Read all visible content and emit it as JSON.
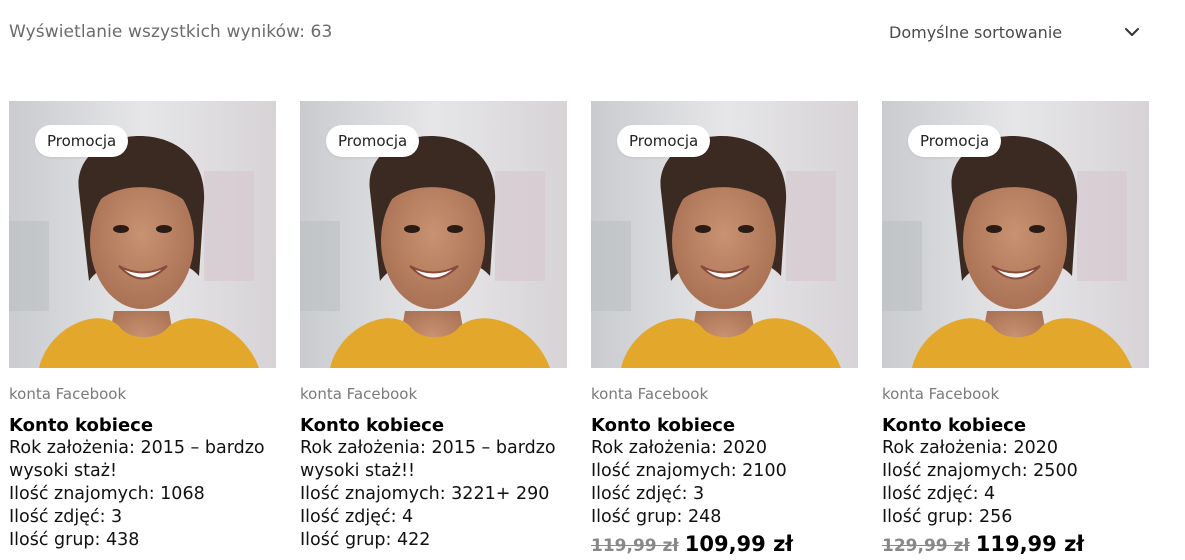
{
  "header": {
    "result_count": "Wyświetlanie wszystkich wyników: 63",
    "sort_label": "Domyślne sortowanie"
  },
  "products": [
    {
      "badge": "Promocja",
      "category": "konta Facebook",
      "title": "Konto kobiece",
      "lines": [
        "Rok założenia: 2015 – bardzo",
        "wysoki staż!",
        "Ilość znajomych: 1068",
        "Ilość zdjęć: 3",
        "Ilość grup: 438"
      ],
      "old_price": "",
      "new_price": ""
    },
    {
      "badge": "Promocja",
      "category": "konta Facebook",
      "title": "Konto kobiece",
      "lines": [
        "Rok założenia: 2015 – bardzo",
        "wysoki staż!!",
        "Ilość znajomych: 3221+ 290",
        "Ilość zdjęć: 4",
        "Ilość grup: 422"
      ],
      "old_price": "",
      "new_price": ""
    },
    {
      "badge": "Promocja",
      "category": "konta Facebook",
      "title": "Konto kobiece",
      "lines": [
        "Rok założenia: 2020",
        "Ilość znajomych: 2100",
        "Ilość zdjęć: 3",
        "Ilość grup: 248"
      ],
      "old_price": "119,99 zł",
      "new_price": "109,99 zł"
    },
    {
      "badge": "Promocja",
      "category": "konta Facebook",
      "title": "Konto kobiece",
      "lines": [
        "Rok założenia: 2020",
        "Ilość znajomych: 2500",
        "Ilość zdjęć: 4",
        "Ilość grup: 256"
      ],
      "old_price": "129,99 zł",
      "new_price": "119,99 zł"
    }
  ],
  "icons": {
    "sort": "chevron-down-icon",
    "product_image": "woman-portrait-image"
  },
  "colors": {
    "shirt": "#e3a82b",
    "muted_text": "#7a7a7a",
    "badge_bg": "#ffffff"
  }
}
